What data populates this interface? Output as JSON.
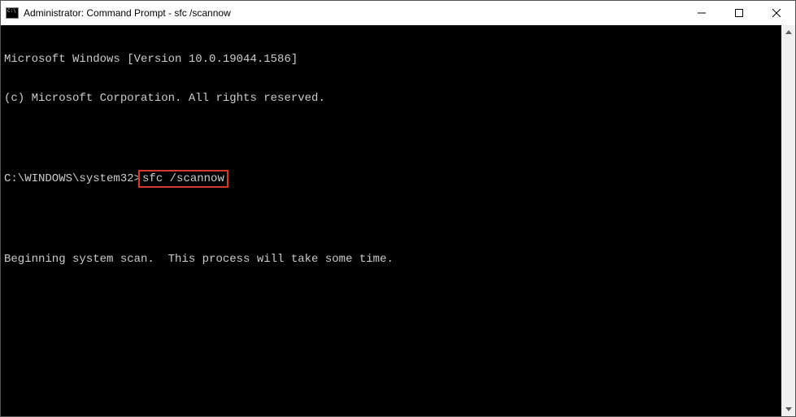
{
  "titlebar": {
    "title": "Administrator: Command Prompt - sfc  /scannow"
  },
  "terminal": {
    "line1": "Microsoft Windows [Version 10.0.19044.1586]",
    "line2": "(c) Microsoft Corporation. All rights reserved.",
    "blank1": "",
    "prompt_prefix": "C:\\WINDOWS\\system32>",
    "command": "sfc /scannow",
    "blank2": "",
    "status": "Beginning system scan.  This process will take some time."
  },
  "highlight": {
    "color": "#d43a2a"
  }
}
